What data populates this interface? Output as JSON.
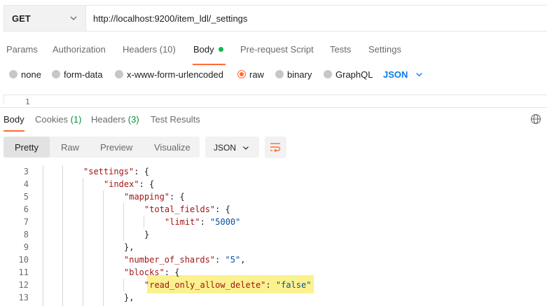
{
  "request": {
    "method": "GET",
    "url": "http://localhost:9200/item_ldl/_settings"
  },
  "request_tabs": [
    {
      "label": "Params",
      "active": false
    },
    {
      "label": "Authorization",
      "active": false
    },
    {
      "label": "Headers (10)",
      "active": false
    },
    {
      "label": "Body",
      "active": true
    },
    {
      "label": "Pre-request Script",
      "active": false
    },
    {
      "label": "Tests",
      "active": false
    },
    {
      "label": "Settings",
      "active": false
    }
  ],
  "body_types": [
    {
      "label": "none",
      "selected": false
    },
    {
      "label": "form-data",
      "selected": false
    },
    {
      "label": "x-www-form-urlencoded",
      "selected": false
    },
    {
      "label": "raw",
      "selected": true
    },
    {
      "label": "binary",
      "selected": false
    },
    {
      "label": "GraphQL",
      "selected": false
    }
  ],
  "raw_format": "JSON",
  "request_editor": {
    "first_line_number": "1"
  },
  "response_tabs": {
    "body": "Body",
    "cookies": "Cookies",
    "cookies_count": "(1)",
    "headers": "Headers",
    "headers_count": "(3)",
    "tests": "Test Results"
  },
  "view_modes": [
    "Pretty",
    "Raw",
    "Preview",
    "Visualize"
  ],
  "active_view": "Pretty",
  "response_format": "JSON",
  "code_lines": [
    {
      "num": "3",
      "segments": [
        {
          "t": "\"settings\"",
          "c": "key"
        },
        {
          "t": ": {",
          "c": "plain"
        }
      ]
    },
    {
      "num": "4",
      "segments": [
        {
          "t": "\"index\"",
          "c": "key"
        },
        {
          "t": ": {",
          "c": "plain"
        }
      ]
    },
    {
      "num": "5",
      "segments": [
        {
          "t": "\"mapping\"",
          "c": "key"
        },
        {
          "t": ": {",
          "c": "plain"
        }
      ]
    },
    {
      "num": "6",
      "segments": [
        {
          "t": "\"total_fields\"",
          "c": "key"
        },
        {
          "t": ": {",
          "c": "plain"
        }
      ]
    },
    {
      "num": "7",
      "segments": [
        {
          "t": "\"limit\"",
          "c": "key"
        },
        {
          "t": ": ",
          "c": "plain"
        },
        {
          "t": "\"5000\"",
          "c": "str"
        }
      ]
    },
    {
      "num": "8",
      "segments": [
        {
          "t": "}",
          "c": "plain"
        }
      ]
    },
    {
      "num": "9",
      "segments": [
        {
          "t": "},",
          "c": "plain"
        }
      ]
    },
    {
      "num": "10",
      "segments": [
        {
          "t": "\"number_of_shards\"",
          "c": "key"
        },
        {
          "t": ": ",
          "c": "plain"
        },
        {
          "t": "\"5\"",
          "c": "str"
        },
        {
          "t": ",",
          "c": "plain"
        }
      ]
    },
    {
      "num": "11",
      "segments": [
        {
          "t": "\"blocks\"",
          "c": "key"
        },
        {
          "t": ": {",
          "c": "plain"
        }
      ]
    },
    {
      "num": "12",
      "segments": [
        {
          "t": "\"read_only_allow_delete\"",
          "c": "key"
        },
        {
          "t": ": ",
          "c": "plain"
        },
        {
          "t": "\"false\"",
          "c": "str"
        }
      ]
    },
    {
      "num": "13",
      "segments": [
        {
          "t": "},",
          "c": "plain"
        }
      ]
    }
  ],
  "colors": {
    "accent": "#ff6c37",
    "link_blue": "#097bed",
    "success_green": "#0cbb52",
    "highlight": "#fbf18f"
  }
}
